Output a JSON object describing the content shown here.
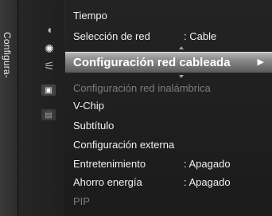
{
  "side_tab": {
    "label": "Configura-"
  },
  "icons": [
    {
      "name": "picture-icon",
      "glyph": "◖"
    },
    {
      "name": "sound-icon",
      "glyph": "✺"
    },
    {
      "name": "channel-icon",
      "glyph": "⚟"
    },
    {
      "name": "setup-icon",
      "glyph": "▣"
    },
    {
      "name": "input-icon",
      "glyph": "▤"
    }
  ],
  "menu": {
    "items": [
      {
        "label": "Tiempo",
        "value": ""
      },
      {
        "label": "Selección de red",
        "value": ": Cable"
      },
      {
        "label": "Configuración red inalámbrica",
        "value": ""
      },
      {
        "label": "V-Chip",
        "value": ""
      },
      {
        "label": "Subtítulo",
        "value": ""
      },
      {
        "label": "Configuración externa",
        "value": ""
      },
      {
        "label": "Entretenimiento",
        "value": ": Apagado"
      },
      {
        "label": "Ahorro energía",
        "value": ": Apagado"
      },
      {
        "label": "PIP",
        "value": ""
      }
    ],
    "selected": {
      "label": "Configuración red cableada",
      "arrow": "▶"
    }
  },
  "colors": {
    "background": "#1c1c1c",
    "highlight": "#8c8c8c",
    "text": "#f0f0f0",
    "disabled_text": "#7d7d7d"
  }
}
